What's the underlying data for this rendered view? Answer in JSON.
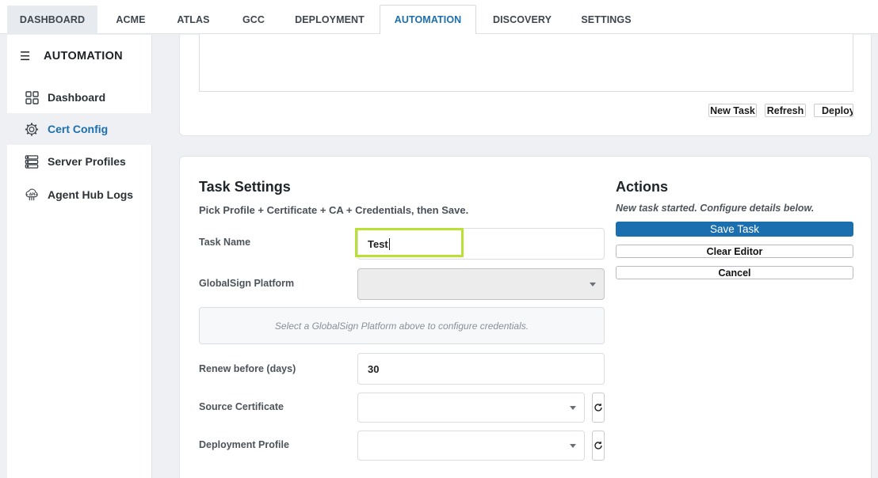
{
  "tabs": [
    {
      "label": "DASHBOARD"
    },
    {
      "label": "ACME"
    },
    {
      "label": "ATLAS"
    },
    {
      "label": "GCC"
    },
    {
      "label": "DEPLOYMENT"
    },
    {
      "label": "AUTOMATION"
    },
    {
      "label": "DISCOVERY"
    },
    {
      "label": "SETTINGS"
    }
  ],
  "sidebar": {
    "title": "AUTOMATION",
    "items": [
      {
        "label": "Dashboard",
        "icon": "grid-icon"
      },
      {
        "label": "Cert Config",
        "icon": "gear-icon"
      },
      {
        "label": "Server Profiles",
        "icon": "server-icon"
      },
      {
        "label": "Agent Hub Logs",
        "icon": "api-icon"
      }
    ]
  },
  "editor": {
    "new_task_label": "New Task",
    "refresh_label": "Refresh",
    "deploy_label": "Deploy"
  },
  "task_settings": {
    "title": "Task Settings",
    "subtitle": "Pick Profile + Certificate + CA + Credentials, then Save.",
    "task_name_label": "Task Name",
    "task_name_value": "Test",
    "platform_label": "GlobalSign Platform",
    "platform_value": "",
    "platform_hint": "Select a GlobalSign Platform above to configure credentials.",
    "renew_label": "Renew before (days)",
    "renew_value": "30",
    "source_cert_label": "Source Certificate",
    "source_cert_value": "",
    "deploy_profile_label": "Deployment Profile",
    "deploy_profile_value": ""
  },
  "actions": {
    "title": "Actions",
    "note": "New task started. Configure details below.",
    "save_label": "Save Task",
    "clear_label": "Clear Editor",
    "cancel_label": "Cancel"
  },
  "colors": {
    "accent": "#1c6fae",
    "highlight": "#b9e033"
  }
}
